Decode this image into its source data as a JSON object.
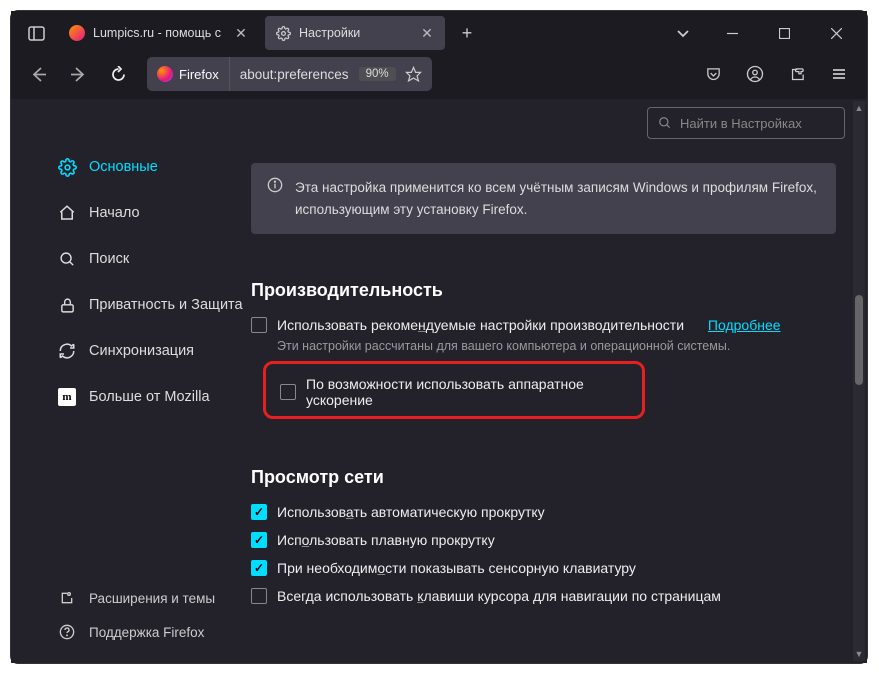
{
  "tabs": {
    "tab1_title": "Lumpics.ru - помощь с компьютером",
    "tab2_title": "Настройки"
  },
  "toolbar": {
    "identity_label": "Firefox",
    "url": "about:preferences",
    "zoom": "90%"
  },
  "search": {
    "placeholder": "Найти в Настройках"
  },
  "sidebar": {
    "general": "Основные",
    "home": "Начало",
    "search": "Поиск",
    "privacy": "Приватность и Защита",
    "sync": "Синхронизация",
    "mozilla": "Больше от Mozilla",
    "extensions": "Расширения и темы",
    "support": "Поддержка Firefox"
  },
  "info": {
    "text": "Эта настройка применится ко всем учётным записям Windows и профилям Firefox, использующим эту установку Firefox."
  },
  "perf": {
    "title": "Производительность",
    "recommended_pre": "Использовать рекоме",
    "recommended_u": "н",
    "recommended_post": "дуемые настройки производительности",
    "learnmore": "Подробнее",
    "hint": "Эти настройки рассчитаны для вашего компьютера и операционной системы.",
    "hw": "По возможности использовать аппаратное ускорение"
  },
  "browsing": {
    "title": "Просмотр сети",
    "auto_pre": "Использов",
    "auto_u": "а",
    "auto_post": "ть автоматическую прокрутку",
    "smooth_pre": "Исп",
    "smooth_u": "о",
    "smooth_post": "льзовать плавную прокрутку",
    "touch_pre": "При необходим",
    "touch_u": "о",
    "touch_post": "сти показывать сенсорную клавиатуру",
    "caret_pre": "Всегда использовать ",
    "caret_u": "к",
    "caret_post": "лавиши курсора для навигации по страницам"
  }
}
